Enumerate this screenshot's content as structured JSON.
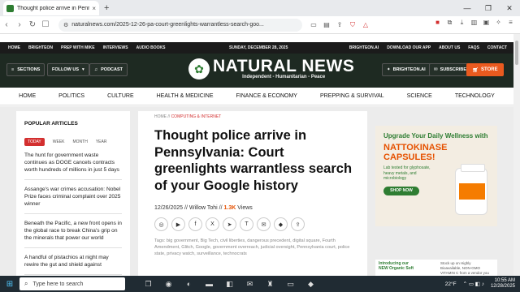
{
  "browser": {
    "tab_title": "Thought police arrive in Pennsylv",
    "tab_close": "×",
    "new_tab": "+",
    "url": "naturalnews.com/2025-12-26-pa-court-greenlights-warrantless-search-goo...",
    "window_controls": [
      "—",
      "❐",
      "✕"
    ]
  },
  "site": {
    "topnav_left": [
      "HOME",
      "BRIGHTEON",
      "PREP WITH MIKE",
      "INTERVIEWS",
      "AUDIO BOOKS"
    ],
    "date": "SUNDAY, DECEMBER 28, 2025",
    "topnav_right": [
      "BRIGHTEON.AI",
      "DOWNLOAD OUR APP",
      "ABOUT US",
      "FAQS",
      "CONTACT"
    ],
    "sections_label": "SECTIONS",
    "follow_label": "FOLLOW US",
    "podcast_label": "PODCAST",
    "logo_name": "NATURAL NEWS",
    "logo_tagline": "Independent - Humanitarian - Peace",
    "brighteon_ai_label": "BRIGHTEON.AI",
    "subscribe_label": "SUBSCRIBE",
    "store_label": "STORE",
    "main_nav": [
      "HOME",
      "POLITICS",
      "CULTURE",
      "HEALTH & MEDICINE",
      "FINANCE & ECONOMY",
      "PREPPING & SURVIVAL",
      "SCIENCE",
      "TECHNOLOGY"
    ]
  },
  "sidebar": {
    "title": "POPULAR ARTICLES",
    "tabs": [
      "TODAY",
      "WEEK",
      "MONTH",
      "YEAR"
    ],
    "items": [
      "The hunt for government waste continues as DOGE cancels contracts worth hundreds of millions in just 5 days",
      "Assange's war crimes accusation: Nobel Prize faces criminal complaint over 2025 winner",
      "Beneath the Pacific, a new front opens in the global race to break China's grip on the minerals that power our world",
      "A handful of pistachios at night may rewire the gut and shield against"
    ]
  },
  "article": {
    "crumb_home": "HOME",
    "crumb_sep": "//",
    "crumb_category": "COMPUTING & INTERNET",
    "headline": "Thought police arrive in Pennsylvania: Court greenlights warrantless search of your Google history",
    "date": "12/26/2025",
    "author_prefix": "// Willow Tohi //",
    "views": "1.3K",
    "views_label": "Views",
    "tags": "Tags: big government, Big Tech, civil liberties, dangerous precedent, digital square, Fourth Amendment, Glitch, Google, government overreach, judicial oversight, Pennsylvania court, police state, privacy watch, surveillance, technocrats"
  },
  "ad": {
    "line1": "Upgrade Your Daily Wellness with",
    "line2": "NATTOKINASE CAPSULES!",
    "line3": "Lab tested for glyphosate, heavy metals, and microbiology",
    "cta": "SHOP NOW",
    "bottom_title": "Introducing our",
    "bottom_title2": "NEW Organic Soft",
    "bottom_red": "NON-GMO VITAMIN C",
    "bottom_small": "Stock up on Highly Bioavailable, NON-GMO VITAMIN C from a vendor you can trust!"
  },
  "taskbar": {
    "search_placeholder": "Type here to search",
    "weather": "22°F",
    "time": "10:55 AM",
    "date": "12/28/2025"
  }
}
